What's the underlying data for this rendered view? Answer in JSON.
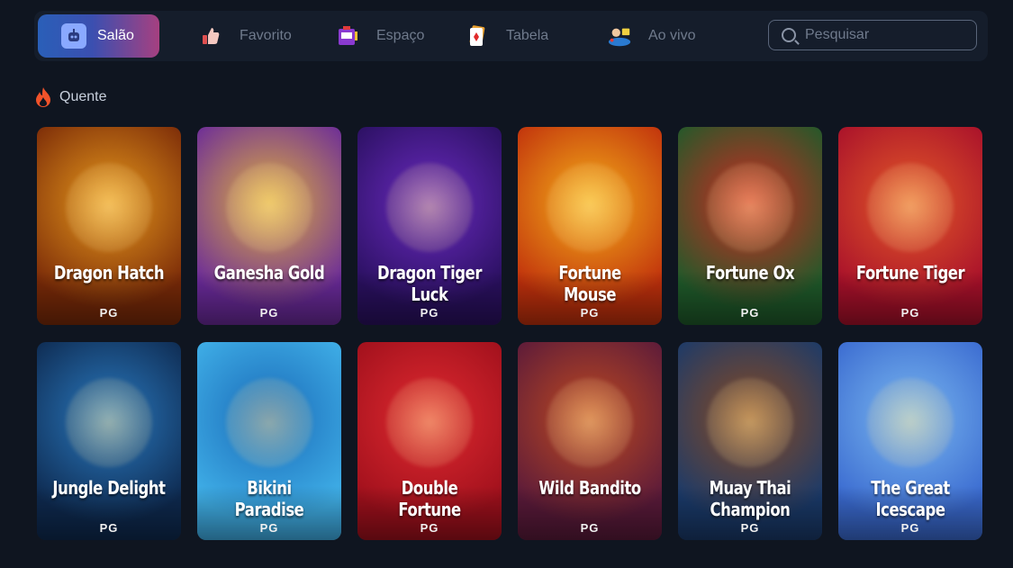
{
  "nav": {
    "tabs": [
      {
        "label": "Salão",
        "icon": "robot-icon",
        "active": true
      },
      {
        "label": "Favorito",
        "icon": "thumbs-up-icon",
        "active": false
      },
      {
        "label": "Espaço",
        "icon": "slot-machine-icon",
        "active": false
      },
      {
        "label": "Tabela",
        "icon": "cards-icon",
        "active": false
      },
      {
        "label": "Ao vivo",
        "icon": "live-dealer-icon",
        "active": false
      }
    ],
    "search": {
      "placeholder": "Pesquisar",
      "value": ""
    }
  },
  "section": {
    "title": "Quente",
    "icon": "flame-icon"
  },
  "games": [
    {
      "name": "Dragon Hatch",
      "provider": "PG",
      "colors": [
        "#7a2a08",
        "#e89a1c"
      ]
    },
    {
      "name": "Ganesha Gold",
      "provider": "PG",
      "colors": [
        "#6a2a9a",
        "#e0b040"
      ]
    },
    {
      "name": "Dragon Tiger Luck",
      "provider": "PG",
      "colors": [
        "#2a1060",
        "#6a2ac0"
      ]
    },
    {
      "name": "Fortune Mouse",
      "provider": "PG",
      "colors": [
        "#c0300c",
        "#f5b019"
      ]
    },
    {
      "name": "Fortune Ox",
      "provider": "PG",
      "colors": [
        "#1f5a2a",
        "#d02a22"
      ]
    },
    {
      "name": "Fortune Tiger",
      "provider": "PG",
      "colors": [
        "#a8102a",
        "#e45a28"
      ]
    },
    {
      "name": "Jungle Delight",
      "provider": "PG",
      "colors": [
        "#0e2a50",
        "#2a7ac0"
      ]
    },
    {
      "name": "Bikini Paradise",
      "provider": "PG",
      "colors": [
        "#40b0e8",
        "#1a6ab8"
      ]
    },
    {
      "name": "Double Fortune",
      "provider": "PG",
      "colors": [
        "#a0101c",
        "#e02a30"
      ]
    },
    {
      "name": "Wild Bandito",
      "provider": "PG",
      "colors": [
        "#5a1a3a",
        "#c04a20"
      ]
    },
    {
      "name": "Muay Thai Champion",
      "provider": "PG",
      "colors": [
        "#1a3a6a",
        "#8a4a20"
      ]
    },
    {
      "name": "The Great Icescape",
      "provider": "PG",
      "colors": [
        "#3a6ad0",
        "#7ab8f0"
      ]
    }
  ]
}
